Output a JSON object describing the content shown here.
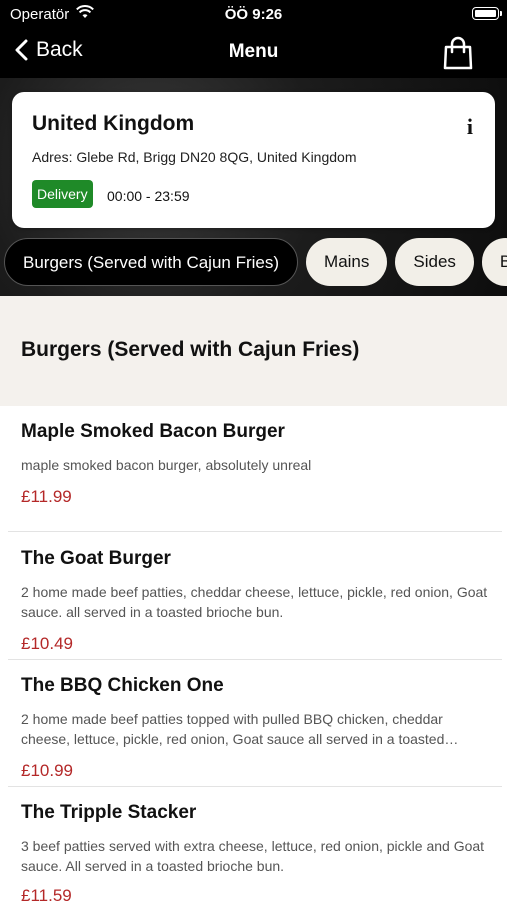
{
  "status_bar": {
    "carrier": "Operatör",
    "time": "ÖÖ 9:26"
  },
  "nav": {
    "back_label": "Back",
    "title": "Menu"
  },
  "store": {
    "name": "United Kingdom",
    "address": "Adres: Glebe Rd, Brigg DN20 8QG, United Kingdom",
    "badge": "Delivery",
    "hours": "00:00 - 23:59",
    "info_glyph": "i"
  },
  "tabs": [
    {
      "label": "Burgers (Served with Cajun Fries)"
    },
    {
      "label": "Mains"
    },
    {
      "label": "Sides"
    },
    {
      "label": "B"
    }
  ],
  "section_title": "Burgers (Served with Cajun Fries)",
  "items": [
    {
      "name": "Maple Smoked Bacon Burger",
      "description": "maple smoked bacon burger, absolutely unreal",
      "price": "£11.99"
    },
    {
      "name": "The Goat Burger",
      "description": "2 home made beef patties, cheddar cheese, lettuce, pickle, red onion, Goat sauce. all served in a toasted brioche bun.",
      "price": "£10.49"
    },
    {
      "name": "The BBQ Chicken One",
      "description": "2 home made beef patties topped with pulled BBQ chicken, cheddar cheese, lettuce, pickle, red onion, Goat sauce all served in a toasted…",
      "price": "£10.99"
    },
    {
      "name": "The Tripple Stacker",
      "description": "3 beef patties served with extra cheese, lettuce, red onion, pickle and Goat sauce. All served in a toasted brioche bun.",
      "price": "£11.59"
    }
  ],
  "colors": {
    "badge": "#1f8a28",
    "price": "#b42828",
    "bar": "#000000"
  }
}
